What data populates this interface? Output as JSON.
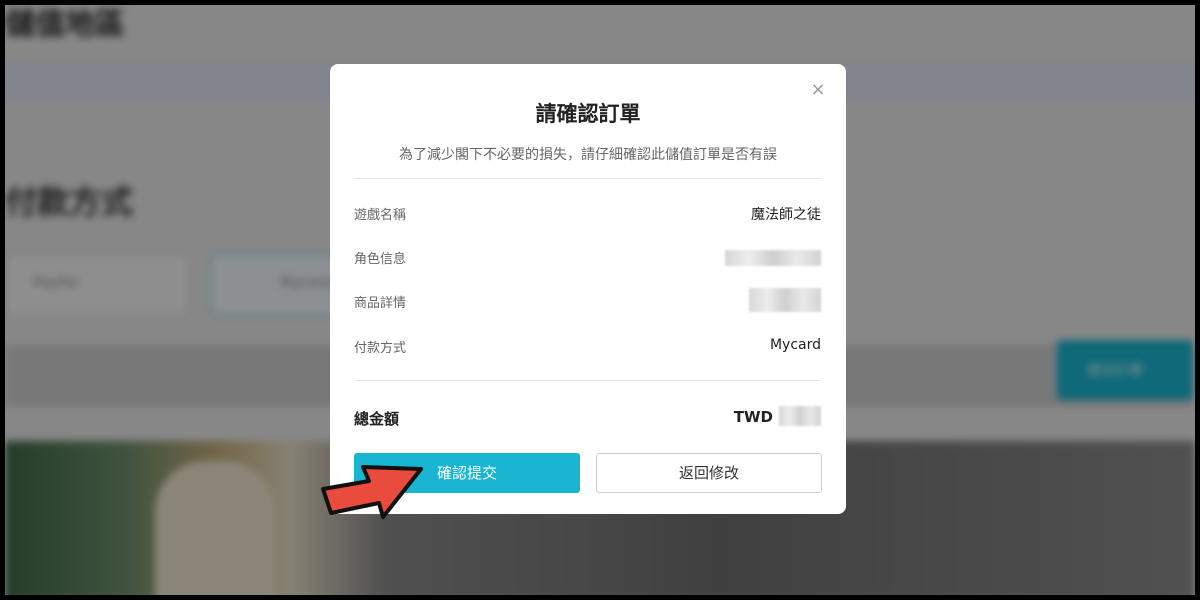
{
  "background": {
    "page_heading": "儲值地區",
    "section_heading": "付款方式",
    "payment_options": [
      "PayPal",
      "Mycard"
    ],
    "submit_label": "提交訂單"
  },
  "dialog": {
    "title": "請確認訂單",
    "subtitle": "為了減少閣下不必要的損失，請仔細確認此儲值訂單是否有誤",
    "close_icon": "×",
    "rows": [
      {
        "label": "遊戲名稱",
        "value": "魔法師之徒"
      },
      {
        "label": "角色信息",
        "value": ""
      },
      {
        "label": "商品詳情",
        "value": ""
      },
      {
        "label": "付款方式",
        "value": "Mycard"
      }
    ],
    "total_label": "總金額",
    "total_currency": "TWD",
    "confirm_label": "確認提交",
    "back_label": "返回修改"
  },
  "colors": {
    "accent": "#19b5d1",
    "arrow": "#e94b3c"
  },
  "annotation": {
    "icon": "red-arrow-icon"
  }
}
